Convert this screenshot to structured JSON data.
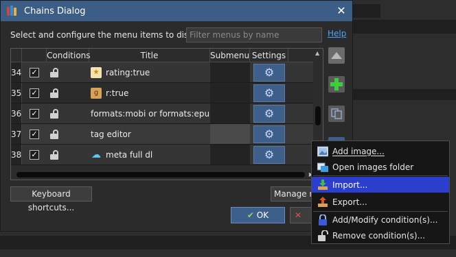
{
  "window": {
    "title": "Chains Dialog"
  },
  "instructions": "Select and configure the menu items to display:",
  "filter": {
    "placeholder": "Filter menus by name",
    "value": ""
  },
  "help_link": "Help",
  "table": {
    "headers": [
      "Conditions",
      "Title",
      "Submenu",
      "Settings"
    ],
    "rows": [
      {
        "num": "34",
        "checked": true,
        "title": "rating:true",
        "icon": "star-rating-icon"
      },
      {
        "num": "35",
        "checked": true,
        "title": "r:true",
        "icon": "bookmark-g-icon"
      },
      {
        "num": "36",
        "checked": true,
        "title": "formats:mobi or formats:epu...",
        "icon": ""
      },
      {
        "num": "37",
        "checked": true,
        "title": "tag editor",
        "icon": ""
      },
      {
        "num": "38",
        "checked": true,
        "title": "meta full dl",
        "icon": "cloud-download-icon"
      }
    ]
  },
  "buttons": {
    "keyboard_shortcuts": "Keyboard shortcuts...",
    "manage": "Manage m",
    "ok": "OK"
  },
  "context_menu": {
    "items": [
      {
        "label": "Add image...",
        "icon": "image-icon",
        "highlighted": false
      },
      {
        "label": "Open images folder",
        "icon": "folder-image-icon",
        "highlighted": false
      },
      {
        "label": "Import...",
        "icon": "import-icon",
        "highlighted": true
      },
      {
        "label": "Export...",
        "icon": "export-icon",
        "highlighted": false
      },
      {
        "label": "Add/Modify condition(s)...",
        "icon": "lock-closed-icon",
        "highlighted": false
      },
      {
        "label": "Remove condition(s)...",
        "icon": "lock-open-icon",
        "highlighted": false
      }
    ]
  },
  "colors": {
    "titlebar": "#3b5d86",
    "accent_button": "#3d5f8a",
    "menu_highlight": "#2b3fcc",
    "link": "#4aa3ff"
  }
}
